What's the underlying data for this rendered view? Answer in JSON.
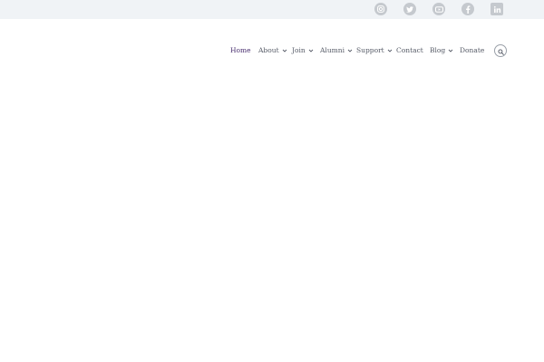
{
  "topbar": {
    "social": [
      {
        "icon": "instagram-icon"
      },
      {
        "icon": "twitter-icon"
      },
      {
        "icon": "youtube-icon"
      },
      {
        "icon": "facebook-icon"
      },
      {
        "icon": "linkedin-icon"
      }
    ],
    "icon_color": "#c5c9ce",
    "background": "#f0f3f6"
  },
  "nav": {
    "items": [
      {
        "label": "Home",
        "active": true
      },
      {
        "label": "About",
        "dropdown": true
      },
      {
        "label": "Join",
        "dropdown": true
      },
      {
        "label": "Alumni",
        "dropdown": true
      },
      {
        "label": "Support",
        "dropdown": true
      },
      {
        "label": "Contact"
      },
      {
        "label": "Blog",
        "dropdown": true
      },
      {
        "label": "Donate"
      }
    ],
    "active_color": "#4a3070",
    "text_color": "#555a66"
  },
  "search": {
    "icon": "search-icon"
  }
}
